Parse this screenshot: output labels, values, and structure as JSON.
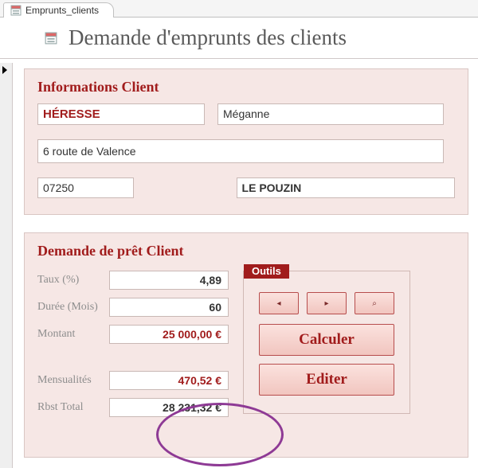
{
  "tab": {
    "label": "Emprunts_clients"
  },
  "header": {
    "title": "Demande d'emprunts des clients"
  },
  "client": {
    "section_title": "Informations Client",
    "lastname": "HÉRESSE",
    "firstname": "Méganne",
    "address": "6 route de Valence",
    "zip": "07250",
    "city": "LE POUZIN"
  },
  "loan": {
    "section_title": "Demande de prêt Client",
    "labels": {
      "rate": "Taux (%)",
      "duration": "Durée (Mois)",
      "amount": "Montant",
      "monthly": "Mensualités",
      "total": "Rbst Total"
    },
    "values": {
      "rate": "4,89",
      "duration": "60",
      "amount": "25 000,00 €",
      "monthly": "470,52 €",
      "total": "28 231,32 €"
    }
  },
  "tools": {
    "label": "Outils",
    "nav": {
      "prev": "◂",
      "next": "▸",
      "search": "⌕"
    },
    "calc": "Calculer",
    "edit": "Editer"
  }
}
